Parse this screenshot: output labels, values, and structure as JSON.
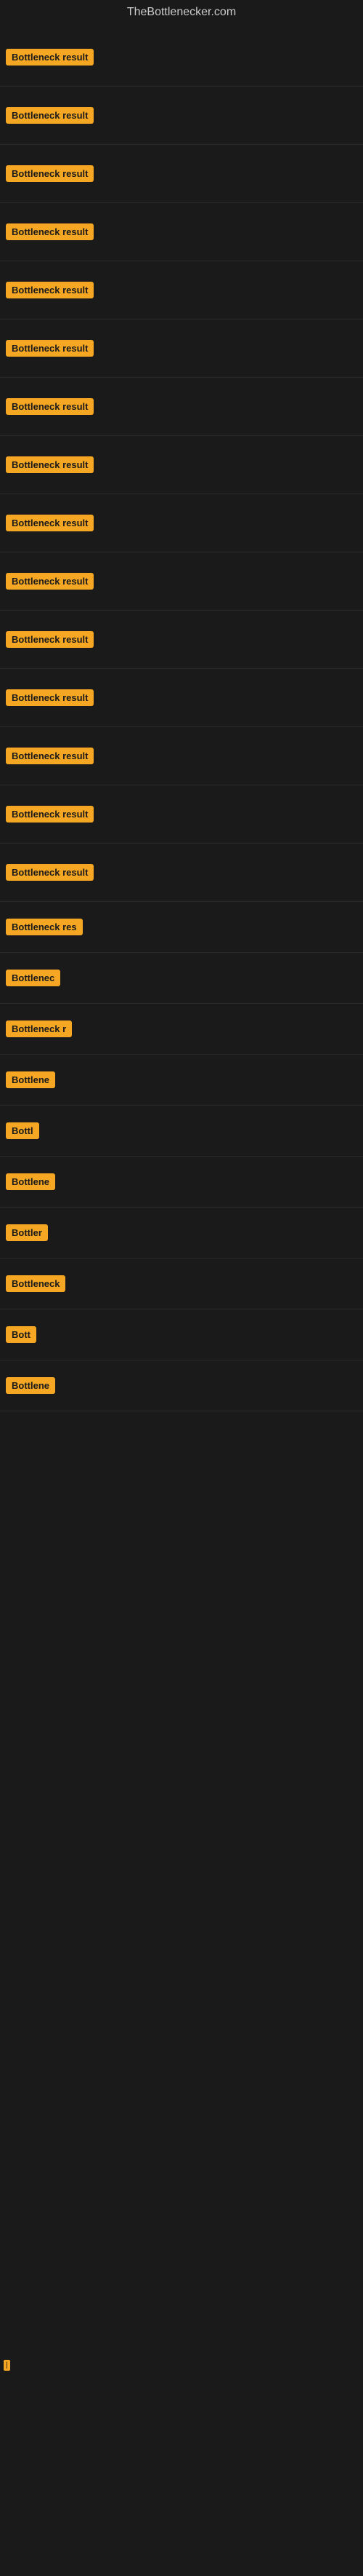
{
  "header": {
    "title": "TheBottlenecker.com"
  },
  "items": [
    {
      "label": "Bottleneck result",
      "width": "full"
    },
    {
      "label": "Bottleneck result",
      "width": "full"
    },
    {
      "label": "Bottleneck result",
      "width": "full"
    },
    {
      "label": "Bottleneck result",
      "width": "full"
    },
    {
      "label": "Bottleneck result",
      "width": "full"
    },
    {
      "label": "Bottleneck result",
      "width": "full"
    },
    {
      "label": "Bottleneck result",
      "width": "full"
    },
    {
      "label": "Bottleneck result",
      "width": "full"
    },
    {
      "label": "Bottleneck result",
      "width": "full"
    },
    {
      "label": "Bottleneck result",
      "width": "full"
    },
    {
      "label": "Bottleneck result",
      "width": "full"
    },
    {
      "label": "Bottleneck result",
      "width": "full"
    },
    {
      "label": "Bottleneck result",
      "width": "full"
    },
    {
      "label": "Bottleneck result",
      "width": "full"
    },
    {
      "label": "Bottleneck result",
      "width": "full"
    },
    {
      "label": "Bottleneck res",
      "width": "partial"
    },
    {
      "label": "Bottlenec",
      "width": "short"
    },
    {
      "label": "Bottleneck r",
      "width": "partial-short"
    },
    {
      "label": "Bottlene",
      "width": "shorter"
    },
    {
      "label": "Bottl",
      "width": "very-short"
    },
    {
      "label": "Bottlene",
      "width": "shorter"
    },
    {
      "label": "Bottler",
      "width": "short2"
    },
    {
      "label": "Bottleneck",
      "width": "medium"
    },
    {
      "label": "Bott",
      "width": "tiny"
    },
    {
      "label": "Bottlene",
      "width": "shorter"
    }
  ],
  "colors": {
    "badge_bg": "#f5a623",
    "badge_text": "#1a1a1a",
    "page_bg": "#1a1a1a",
    "header_text": "#cccccc"
  }
}
